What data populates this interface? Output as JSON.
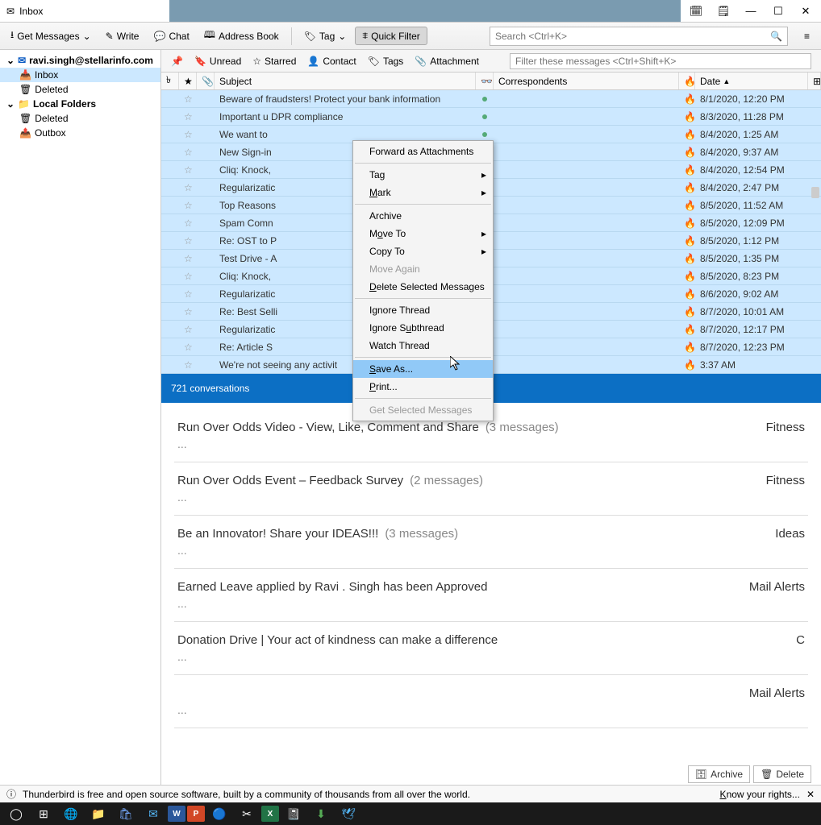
{
  "window": {
    "title": "Inbox"
  },
  "toolbar": {
    "get_messages": "Get Messages",
    "write": "Write",
    "chat": "Chat",
    "address_book": "Address Book",
    "tag": "Tag",
    "quick_filter": "Quick Filter",
    "search_placeholder": "Search <Ctrl+K>"
  },
  "sidebar": {
    "account": "ravi.singh@stellarinfo.com",
    "items": [
      {
        "label": "Inbox",
        "selected": true
      },
      {
        "label": "Deleted"
      }
    ],
    "local_label": "Local Folders",
    "local_items": [
      {
        "label": "Deleted"
      },
      {
        "label": "Outbox"
      }
    ]
  },
  "filter": {
    "unread": "Unread",
    "starred": "Starred",
    "contact": "Contact",
    "tags": "Tags",
    "attachment": "Attachment",
    "placeholder": "Filter these messages <Ctrl+Shift+K>"
  },
  "columns": {
    "subject": "Subject",
    "correspondents": "Correspondents",
    "date": "Date"
  },
  "messages": [
    {
      "subject": "Beware of fraudsters! Protect your bank information",
      "date": "8/1/2020, 12:20 PM"
    },
    {
      "subject": "Important u                        DPR compliance",
      "date": "8/3/2020, 11:28 PM"
    },
    {
      "subject": "We want to",
      "date": "8/4/2020, 1:25 AM"
    },
    {
      "subject": "New Sign-in",
      "date": "8/4/2020, 9:37 AM"
    },
    {
      "subject": "Cliq: Knock,",
      "date": "8/4/2020, 12:54 PM"
    },
    {
      "subject": "Regularizatic",
      "date": "8/4/2020, 2:47 PM"
    },
    {
      "subject": "Top Reasons",
      "date": "8/5/2020, 11:52 AM"
    },
    {
      "subject": "Spam Comn",
      "date": "8/5/2020, 12:09 PM"
    },
    {
      "subject": "Re: OST to P",
      "date": "8/5/2020, 1:12 PM"
    },
    {
      "subject": "Test Drive - A",
      "date": "8/5/2020, 1:35 PM"
    },
    {
      "subject": "Cliq: Knock,",
      "date": "8/5/2020, 8:23 PM"
    },
    {
      "subject": "Regularizatic",
      "date": "8/6/2020, 9:02 AM"
    },
    {
      "subject": "Re: Best Selli",
      "date": "8/7/2020, 10:01 AM"
    },
    {
      "subject": "Regularizatic",
      "date": "8/7/2020, 12:17 PM"
    },
    {
      "subject": "Re: Article S",
      "date": "8/7/2020, 12:23 PM"
    },
    {
      "subject": "We're not seeing any activit",
      "date": "3:37 AM"
    }
  ],
  "context_menu": {
    "forward": "Forward as Attachments",
    "tag": "Tag",
    "mark": "Mark",
    "archive": "Archive",
    "move_to": "Move To",
    "copy_to": "Copy To",
    "move_again": "Move Again",
    "delete_sel": "Delete Selected Messages",
    "ignore_thread": "Ignore Thread",
    "ignore_subthread": "Ignore Subthread",
    "watch_thread": "Watch Thread",
    "save_as": "Save As...",
    "print": "Print...",
    "get_sel": "Get Selected Messages"
  },
  "conv_header": "721 conversations",
  "conv_actions": {
    "archive": "Archive",
    "delete": "Delete"
  },
  "conversations": [
    {
      "title": "Run Over Odds Video - View, Like, Comment and Share",
      "count": "(3 messages)",
      "right": "Fitness"
    },
    {
      "title": "Run Over Odds Event – Feedback Survey",
      "count": "(2 messages)",
      "right": "Fitness"
    },
    {
      "title": "Be an Innovator! Share your IDEAS!!!",
      "count": "(3 messages)",
      "right": "Ideas"
    },
    {
      "title": "Earned Leave applied by Ravi . Singh has been Approved",
      "count": "",
      "right": "Mail Alerts"
    },
    {
      "title": "Donation Drive | Your act of kindness can make a difference",
      "count": "",
      "right": "C"
    },
    {
      "title": "",
      "count": "",
      "right": "Mail Alerts"
    }
  ],
  "statusbar": {
    "text": "Thunderbird is free and open source software, built by a community of thousands from all over the world.",
    "rights": "Know your rights..."
  }
}
